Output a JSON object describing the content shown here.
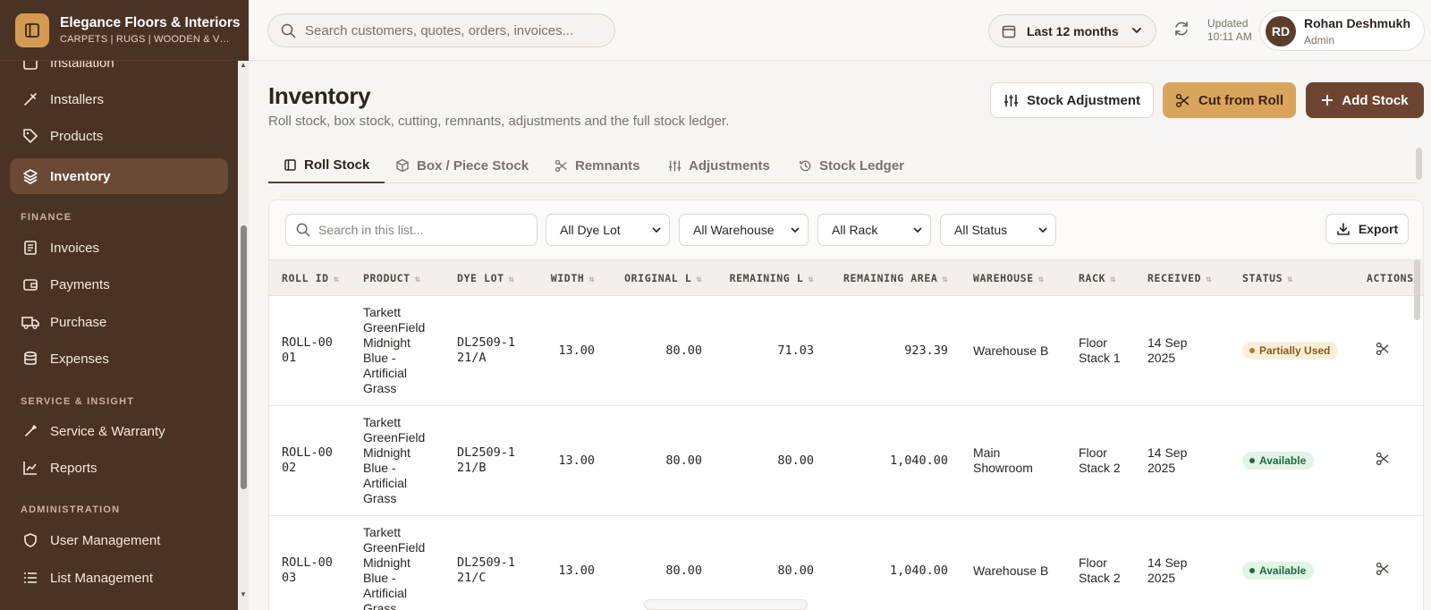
{
  "brand": {
    "name": "Elegance Floors & Interiors",
    "subtitle": "CARPETS | RUGS | WOODEN & VINYL"
  },
  "sidebar": {
    "items_top": [
      {
        "label": "Installation",
        "icon": "calendar-icon"
      },
      {
        "label": "Installers",
        "icon": "tool-icon"
      },
      {
        "label": "Products",
        "icon": "tag-icon"
      },
      {
        "label": "Inventory",
        "icon": "layers-icon",
        "active": true
      }
    ],
    "section_finance": "FINANCE",
    "items_finance": [
      {
        "label": "Invoices",
        "icon": "receipt-icon"
      },
      {
        "label": "Payments",
        "icon": "wallet-icon"
      },
      {
        "label": "Purchase",
        "icon": "truck-icon"
      },
      {
        "label": "Expenses",
        "icon": "database-icon"
      }
    ],
    "section_service": "SERVICE & INSIGHT",
    "items_service": [
      {
        "label": "Service & Warranty",
        "icon": "wrench-icon"
      },
      {
        "label": "Reports",
        "icon": "chart-icon"
      }
    ],
    "section_admin": "ADMINISTRATION",
    "items_admin": [
      {
        "label": "User Management",
        "icon": "shield-icon"
      },
      {
        "label": "List Management",
        "icon": "list-icon"
      }
    ]
  },
  "topbar": {
    "search_placeholder": "Search customers, quotes, orders, invoices...",
    "range_label": "Last 12 months",
    "updated_label": "Updated",
    "updated_time": "10:11 AM",
    "user_initials": "RD",
    "user_name": "Rohan Deshmukh",
    "user_role": "Admin"
  },
  "page": {
    "title": "Inventory",
    "subtitle": "Roll stock, box stock, cutting, remnants, adjustments and the full stock ledger.",
    "btn_adjust": "Stock Adjustment",
    "btn_cut": "Cut from Roll",
    "btn_add": "Add Stock"
  },
  "tabs": [
    {
      "label": "Roll Stock",
      "icon": "roll-icon",
      "active": true
    },
    {
      "label": "Box / Piece Stock",
      "icon": "box-icon"
    },
    {
      "label": "Remnants",
      "icon": "scissors-icon"
    },
    {
      "label": "Adjustments",
      "icon": "sliders-icon"
    },
    {
      "label": "Stock Ledger",
      "icon": "history-icon"
    }
  ],
  "filters": {
    "search_placeholder": "Search in this list...",
    "dye_lot": "All Dye Lot",
    "warehouse": "All Warehouse",
    "rack": "All Rack",
    "status": "All Status",
    "export_label": "Export"
  },
  "table": {
    "columns": [
      "ROLL ID",
      "PRODUCT",
      "DYE LOT",
      "WIDTH",
      "ORIGINAL L",
      "REMAINING L",
      "REMAINING AREA",
      "WAREHOUSE",
      "RACK",
      "RECEIVED",
      "STATUS",
      "ACTIONS"
    ],
    "rows": [
      {
        "roll_id": "ROLL-0001",
        "product": "Tarkett GreenField Midnight Blue - Artificial Grass",
        "dye_lot": "DL2509-121/A",
        "width": "13.00",
        "original": "80.00",
        "remaining": "71.03",
        "area": "923.39",
        "warehouse": "Warehouse B",
        "rack": "Floor Stack 1",
        "received": "14 Sep 2025",
        "status": "Partially Used",
        "status_kind": "partial"
      },
      {
        "roll_id": "ROLL-0002",
        "product": "Tarkett GreenField Midnight Blue - Artificial Grass",
        "dye_lot": "DL2509-121/B",
        "width": "13.00",
        "original": "80.00",
        "remaining": "80.00",
        "area": "1,040.00",
        "warehouse": "Main Showroom",
        "rack": "Floor Stack 2",
        "received": "14 Sep 2025",
        "status": "Available",
        "status_kind": "avail"
      },
      {
        "roll_id": "ROLL-0003",
        "product": "Tarkett GreenField Midnight Blue - Artificial Grass",
        "dye_lot": "DL2509-121/C",
        "width": "13.00",
        "original": "80.00",
        "remaining": "80.00",
        "area": "1,040.00",
        "warehouse": "Warehouse B",
        "rack": "Floor Stack 2",
        "received": "14 Sep 2025",
        "status": "Available",
        "status_kind": "avail"
      }
    ]
  },
  "colors": {
    "sidebar_bg": "#4a3224",
    "accent": "#d9a45c",
    "primary": "#6b4530"
  }
}
